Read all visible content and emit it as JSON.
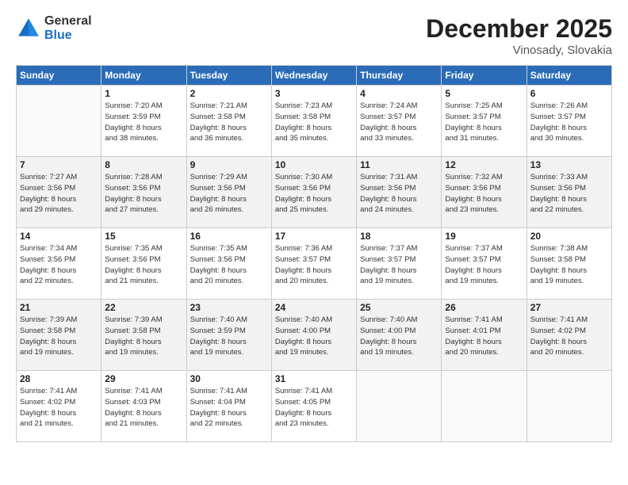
{
  "logo": {
    "general": "General",
    "blue": "Blue"
  },
  "header": {
    "month": "December 2025",
    "location": "Vinosady, Slovakia"
  },
  "weekdays": [
    "Sunday",
    "Monday",
    "Tuesday",
    "Wednesday",
    "Thursday",
    "Friday",
    "Saturday"
  ],
  "weeks": [
    [
      {
        "day": "",
        "sunrise": "",
        "sunset": "",
        "daylight": ""
      },
      {
        "day": "1",
        "sunrise": "Sunrise: 7:20 AM",
        "sunset": "Sunset: 3:59 PM",
        "daylight": "Daylight: 8 hours and 38 minutes."
      },
      {
        "day": "2",
        "sunrise": "Sunrise: 7:21 AM",
        "sunset": "Sunset: 3:58 PM",
        "daylight": "Daylight: 8 hours and 36 minutes."
      },
      {
        "day": "3",
        "sunrise": "Sunrise: 7:23 AM",
        "sunset": "Sunset: 3:58 PM",
        "daylight": "Daylight: 8 hours and 35 minutes."
      },
      {
        "day": "4",
        "sunrise": "Sunrise: 7:24 AM",
        "sunset": "Sunset: 3:57 PM",
        "daylight": "Daylight: 8 hours and 33 minutes."
      },
      {
        "day": "5",
        "sunrise": "Sunrise: 7:25 AM",
        "sunset": "Sunset: 3:57 PM",
        "daylight": "Daylight: 8 hours and 31 minutes."
      },
      {
        "day": "6",
        "sunrise": "Sunrise: 7:26 AM",
        "sunset": "Sunset: 3:57 PM",
        "daylight": "Daylight: 8 hours and 30 minutes."
      }
    ],
    [
      {
        "day": "7",
        "sunrise": "Sunrise: 7:27 AM",
        "sunset": "Sunset: 3:56 PM",
        "daylight": "Daylight: 8 hours and 29 minutes."
      },
      {
        "day": "8",
        "sunrise": "Sunrise: 7:28 AM",
        "sunset": "Sunset: 3:56 PM",
        "daylight": "Daylight: 8 hours and 27 minutes."
      },
      {
        "day": "9",
        "sunrise": "Sunrise: 7:29 AM",
        "sunset": "Sunset: 3:56 PM",
        "daylight": "Daylight: 8 hours and 26 minutes."
      },
      {
        "day": "10",
        "sunrise": "Sunrise: 7:30 AM",
        "sunset": "Sunset: 3:56 PM",
        "daylight": "Daylight: 8 hours and 25 minutes."
      },
      {
        "day": "11",
        "sunrise": "Sunrise: 7:31 AM",
        "sunset": "Sunset: 3:56 PM",
        "daylight": "Daylight: 8 hours and 24 minutes."
      },
      {
        "day": "12",
        "sunrise": "Sunrise: 7:32 AM",
        "sunset": "Sunset: 3:56 PM",
        "daylight": "Daylight: 8 hours and 23 minutes."
      },
      {
        "day": "13",
        "sunrise": "Sunrise: 7:33 AM",
        "sunset": "Sunset: 3:56 PM",
        "daylight": "Daylight: 8 hours and 22 minutes."
      }
    ],
    [
      {
        "day": "14",
        "sunrise": "Sunrise: 7:34 AM",
        "sunset": "Sunset: 3:56 PM",
        "daylight": "Daylight: 8 hours and 22 minutes."
      },
      {
        "day": "15",
        "sunrise": "Sunrise: 7:35 AM",
        "sunset": "Sunset: 3:56 PM",
        "daylight": "Daylight: 8 hours and 21 minutes."
      },
      {
        "day": "16",
        "sunrise": "Sunrise: 7:35 AM",
        "sunset": "Sunset: 3:56 PM",
        "daylight": "Daylight: 8 hours and 20 minutes."
      },
      {
        "day": "17",
        "sunrise": "Sunrise: 7:36 AM",
        "sunset": "Sunset: 3:57 PM",
        "daylight": "Daylight: 8 hours and 20 minutes."
      },
      {
        "day": "18",
        "sunrise": "Sunrise: 7:37 AM",
        "sunset": "Sunset: 3:57 PM",
        "daylight": "Daylight: 8 hours and 19 minutes."
      },
      {
        "day": "19",
        "sunrise": "Sunrise: 7:37 AM",
        "sunset": "Sunset: 3:57 PM",
        "daylight": "Daylight: 8 hours and 19 minutes."
      },
      {
        "day": "20",
        "sunrise": "Sunrise: 7:38 AM",
        "sunset": "Sunset: 3:58 PM",
        "daylight": "Daylight: 8 hours and 19 minutes."
      }
    ],
    [
      {
        "day": "21",
        "sunrise": "Sunrise: 7:39 AM",
        "sunset": "Sunset: 3:58 PM",
        "daylight": "Daylight: 8 hours and 19 minutes."
      },
      {
        "day": "22",
        "sunrise": "Sunrise: 7:39 AM",
        "sunset": "Sunset: 3:58 PM",
        "daylight": "Daylight: 8 hours and 19 minutes."
      },
      {
        "day": "23",
        "sunrise": "Sunrise: 7:40 AM",
        "sunset": "Sunset: 3:59 PM",
        "daylight": "Daylight: 8 hours and 19 minutes."
      },
      {
        "day": "24",
        "sunrise": "Sunrise: 7:40 AM",
        "sunset": "Sunset: 4:00 PM",
        "daylight": "Daylight: 8 hours and 19 minutes."
      },
      {
        "day": "25",
        "sunrise": "Sunrise: 7:40 AM",
        "sunset": "Sunset: 4:00 PM",
        "daylight": "Daylight: 8 hours and 19 minutes."
      },
      {
        "day": "26",
        "sunrise": "Sunrise: 7:41 AM",
        "sunset": "Sunset: 4:01 PM",
        "daylight": "Daylight: 8 hours and 20 minutes."
      },
      {
        "day": "27",
        "sunrise": "Sunrise: 7:41 AM",
        "sunset": "Sunset: 4:02 PM",
        "daylight": "Daylight: 8 hours and 20 minutes."
      }
    ],
    [
      {
        "day": "28",
        "sunrise": "Sunrise: 7:41 AM",
        "sunset": "Sunset: 4:02 PM",
        "daylight": "Daylight: 8 hours and 21 minutes."
      },
      {
        "day": "29",
        "sunrise": "Sunrise: 7:41 AM",
        "sunset": "Sunset: 4:03 PM",
        "daylight": "Daylight: 8 hours and 21 minutes."
      },
      {
        "day": "30",
        "sunrise": "Sunrise: 7:41 AM",
        "sunset": "Sunset: 4:04 PM",
        "daylight": "Daylight: 8 hours and 22 minutes."
      },
      {
        "day": "31",
        "sunrise": "Sunrise: 7:41 AM",
        "sunset": "Sunset: 4:05 PM",
        "daylight": "Daylight: 8 hours and 23 minutes."
      },
      {
        "day": "",
        "sunrise": "",
        "sunset": "",
        "daylight": ""
      },
      {
        "day": "",
        "sunrise": "",
        "sunset": "",
        "daylight": ""
      },
      {
        "day": "",
        "sunrise": "",
        "sunset": "",
        "daylight": ""
      }
    ]
  ]
}
